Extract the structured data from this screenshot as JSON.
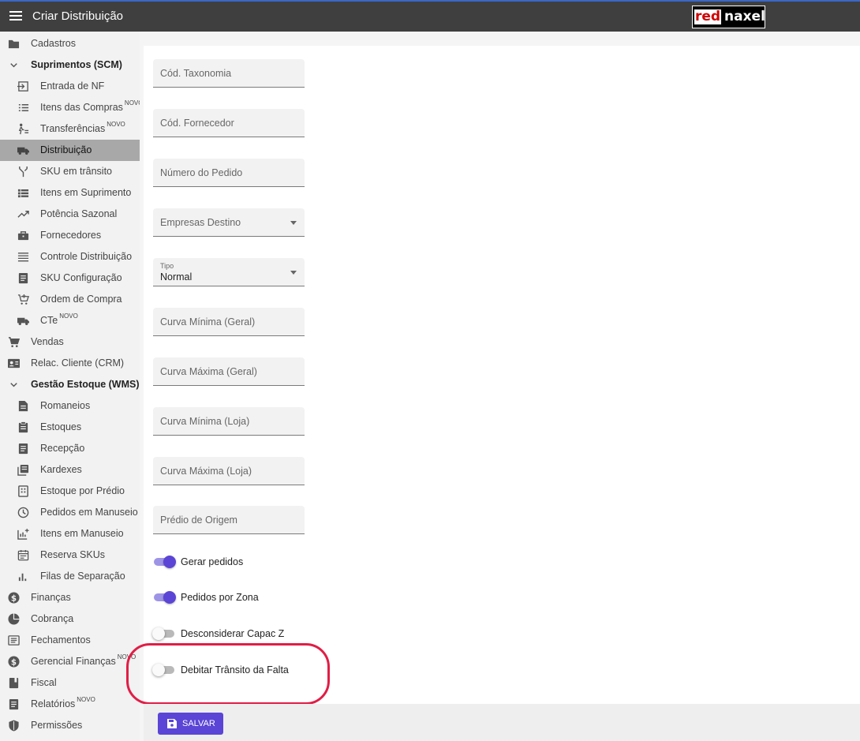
{
  "header": {
    "title": "Criar Distribuição",
    "logo_left": "red",
    "logo_right": "naxel"
  },
  "sidebar": {
    "items": [
      {
        "label": "Cadastros",
        "badge": "",
        "icon": "folder-icon"
      },
      {
        "label": "Suprimentos (SCM)",
        "badge": "",
        "icon": "chevron-down-icon"
      },
      {
        "label": "Entrada de NF",
        "badge": "",
        "icon": "login-icon"
      },
      {
        "label": "Itens das Compras",
        "badge": "NOVO",
        "icon": "list-icon"
      },
      {
        "label": "Transferências",
        "badge": "NOVO",
        "icon": "person-transfer-icon"
      },
      {
        "label": "Distribuição",
        "badge": "",
        "icon": "truck-icon"
      },
      {
        "label": "SKU em trânsito",
        "badge": "",
        "icon": "merge-icon"
      },
      {
        "label": "Itens em Suprimento",
        "badge": "",
        "icon": "list-icon"
      },
      {
        "label": "Potência Sazonal",
        "badge": "",
        "icon": "trending-up-icon"
      },
      {
        "label": "Fornecedores",
        "badge": "",
        "icon": "briefcase-icon"
      },
      {
        "label": "Controle Distribuição",
        "badge": "",
        "icon": "lines-icon"
      },
      {
        "label": "SKU Configuração",
        "badge": "",
        "icon": "document-icon"
      },
      {
        "label": "Ordem de Compra",
        "badge": "",
        "icon": "cart-add-icon"
      },
      {
        "label": "CTe",
        "badge": "NOVO",
        "icon": "truck-icon"
      },
      {
        "label": "Vendas",
        "badge": "",
        "icon": "cart-icon"
      },
      {
        "label": "Relac. Cliente (CRM)",
        "badge": "",
        "icon": "contact-card-icon"
      },
      {
        "label": "Gestão Estoque (WMS)",
        "badge": "",
        "icon": "chevron-down-icon"
      },
      {
        "label": "Romaneios",
        "badge": "",
        "icon": "document-icon"
      },
      {
        "label": "Estoques",
        "badge": "",
        "icon": "clipboard-icon"
      },
      {
        "label": "Recepção",
        "badge": "",
        "icon": "document-icon"
      },
      {
        "label": "Kardexes",
        "badge": "",
        "icon": "library-icon"
      },
      {
        "label": "Estoque por Prédio",
        "badge": "",
        "icon": "building-icon"
      },
      {
        "label": "Pedidos em Manuseio",
        "badge": "",
        "icon": "clock-icon"
      },
      {
        "label": "Itens em Manuseio",
        "badge": "",
        "icon": "chart-add-icon"
      },
      {
        "label": "Reserva SKUs",
        "badge": "",
        "icon": "calendar-icon"
      },
      {
        "label": "Filas de Separação",
        "badge": "",
        "icon": "bar-chart-icon"
      },
      {
        "label": "Finanças",
        "badge": "",
        "icon": "dollar-icon"
      },
      {
        "label": "Cobrança",
        "badge": "",
        "icon": "pie-chart-icon"
      },
      {
        "label": "Fechamentos",
        "badge": "",
        "icon": "receipt-icon"
      },
      {
        "label": "Gerencial Finanças",
        "badge": "NOVO",
        "icon": "dollar-icon"
      },
      {
        "label": "Fiscal",
        "badge": "",
        "icon": "book-icon"
      },
      {
        "label": "Relatórios",
        "badge": "NOVO",
        "icon": "document-icon"
      },
      {
        "label": "Permissões",
        "badge": "",
        "icon": "shield-icon"
      }
    ]
  },
  "form": {
    "cod_taxonomia": "Cód. Taxonomia",
    "cod_fornecedor": "Cód. Fornecedor",
    "numero_pedido": "Número do Pedido",
    "empresas_destino": "Empresas Destino",
    "tipo_label": "Tipo",
    "tipo_value": "Normal",
    "curva_min_geral": "Curva Mínima (Geral)",
    "curva_max_geral": "Curva Máxima (Geral)",
    "curva_min_loja": "Curva Mínima (Loja)",
    "curva_max_loja": "Curva Máxima (Loja)",
    "predio_origem": "Prédio de Origem"
  },
  "toggles": {
    "gerar_pedidos": {
      "label": "Gerar pedidos",
      "state": "on"
    },
    "pedidos_zona": {
      "label": "Pedidos por Zona",
      "state": "on"
    },
    "desconsiderar_capac": {
      "label": "Desconsiderar Capac Z",
      "state": "off"
    },
    "debitar_transito": {
      "label": "Debitar Trânsito da Falta",
      "state": "off"
    }
  },
  "actions": {
    "save_label": "SALVAR"
  },
  "colors": {
    "accent": "#5b45d6",
    "highlight": "#e01e46",
    "topbar": "#3f3f3f"
  }
}
